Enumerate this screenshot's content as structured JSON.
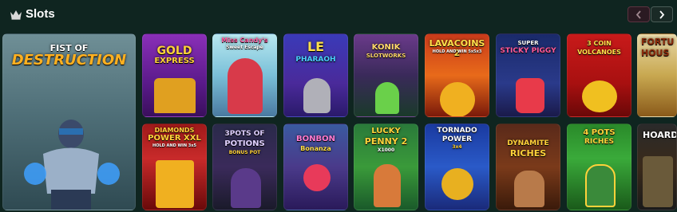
{
  "section": {
    "title": "Slots",
    "icon": "crown-icon"
  },
  "nav": {
    "prev": "chevron-left-icon",
    "next": "chevron-right-icon"
  },
  "featured": {
    "title_line1": "FIST OF",
    "title_line2": "DESTRUCTION"
  },
  "games_top": [
    {
      "line1": "GOLD",
      "line2": "EXPRESS"
    },
    {
      "line1": "Miss Candy's",
      "line2": "Sweet Escape"
    },
    {
      "line1": "LE",
      "line2": "PHARAOH"
    },
    {
      "line1": "KONIK",
      "line2": "SLOTWORKS"
    },
    {
      "line1": "LAVACOINS 2",
      "line2": "HOLD AND WIN 5x5x3"
    },
    {
      "line1": "SUPER",
      "line2": "STICKY PIGGY"
    },
    {
      "line1": "3 COIN",
      "line2": "VOLCANOES"
    },
    {
      "line1": "FORTU",
      "line2": "HOUS"
    }
  ],
  "games_bottom": [
    {
      "line1": "DIAMONDS",
      "line2": "POWER XXL",
      "line3": "HOLD AND WIN 3x5"
    },
    {
      "line1": "3POTS OF",
      "line2": "POTIONS",
      "line3": "BONUS POT"
    },
    {
      "line1": "BONBON",
      "line2": "Bonanza"
    },
    {
      "line1": "LUCKY",
      "line2": "PENNY 2",
      "line3": "X1000"
    },
    {
      "line1": "TORNADO",
      "line2": "POWER",
      "line3": "3x4"
    },
    {
      "line1": "DYNAMITE",
      "line2": "RICHES"
    },
    {
      "line1": "4 POTS",
      "line2": "RICHES"
    },
    {
      "line1": "HOARD"
    }
  ]
}
